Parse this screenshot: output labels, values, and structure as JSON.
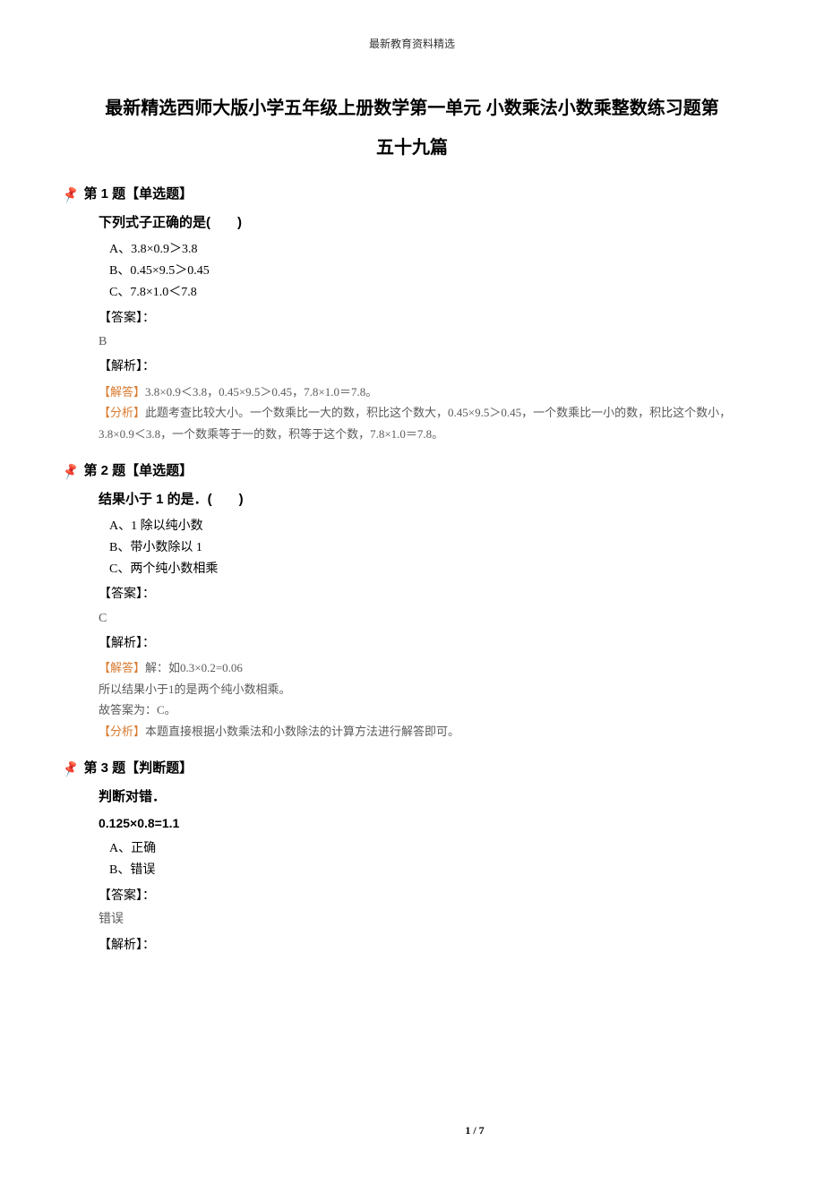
{
  "header": "最新教育资料精选",
  "title_line1": "最新精选西师大版小学五年级上册数学第一单元 小数乘法小数乘整数练习题第",
  "title_line2": "五十九篇",
  "questions": [
    {
      "header": "第 1 题【单选题】",
      "stem": "下列式子正确的是(　　)",
      "options": [
        "A、3.8×0.9＞3.8",
        "B、0.45×9.5＞0.45",
        "C、7.8×1.0＜7.8"
      ],
      "answer_label": "【答案】：",
      "answer": "B",
      "analysis_label": "【解析】：",
      "analysis": [
        {
          "tag": "【解答】",
          "text": "3.8×0.9＜3.8，0.45×9.5＞0.45，7.8×1.0＝7.8。"
        },
        {
          "tag": "【分析】",
          "text": "此题考查比较大小。一个数乘比一大的数，积比这个数大，0.45×9.5＞0.45，一个数乘比一小的数，积比这个数小，3.8×0.9＜3.8，一个数乘等于一的数，积等于这个数，7.8×1.0＝7.8。"
        }
      ]
    },
    {
      "header": "第 2 题【单选题】",
      "stem": "结果小于 1 的是．(　　)",
      "options": [
        "A、1 除以纯小数",
        "B、带小数除以 1",
        "C、两个纯小数相乘"
      ],
      "answer_label": "【答案】：",
      "answer": "C",
      "analysis_label": "【解析】：",
      "analysis": [
        {
          "tag": "【解答】",
          "text": "解：如0.3×0.2=0.06"
        },
        {
          "tag": "",
          "text": "所以结果小于1的是两个纯小数相乘。"
        },
        {
          "tag": "",
          "text": "故答案为：C。"
        },
        {
          "tag": "【分析】",
          "text": "本题直接根据小数乘法和小数除法的计算方法进行解答即可。"
        }
      ]
    },
    {
      "header": "第 3 题【判断题】",
      "stem": "判断对错．",
      "sub": "0.125×0.8=1.1",
      "options": [
        "A、正确",
        "B、错误"
      ],
      "answer_label": "【答案】：",
      "answer": "错误",
      "analysis_label": "【解析】："
    }
  ],
  "footer": "1 / 7"
}
